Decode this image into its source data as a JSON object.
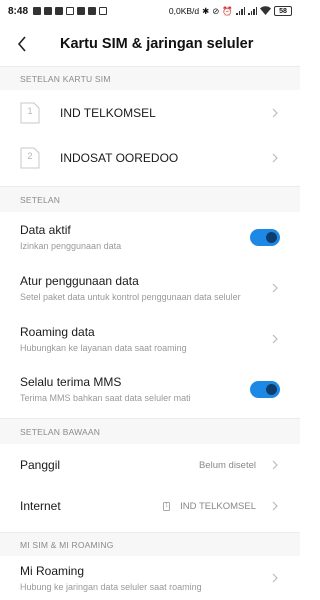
{
  "status_bar": {
    "time": "8:48",
    "network_speed": "0,0KB/d",
    "battery": "58"
  },
  "header": {
    "title": "Kartu SIM & jaringan seluler"
  },
  "sections": {
    "sim_settings": "SETELAN KARTU SIM",
    "settings": "SETELAN",
    "default_settings": "SETELAN BAWAAN",
    "mi_sim": "MI SIM & MI ROAMING"
  },
  "sims": [
    {
      "slot": "1",
      "name": "IND TELKOMSEL"
    },
    {
      "slot": "2",
      "name": "INDOSAT OOREDOO"
    }
  ],
  "settings": {
    "data_aktif": {
      "title": "Data aktif",
      "subtitle": "Izinkan penggunaan data",
      "enabled": true
    },
    "atur_data": {
      "title": "Atur penggunaan data",
      "subtitle": "Setel paket data untuk kontrol penggunaan data seluler"
    },
    "roaming": {
      "title": "Roaming data",
      "subtitle": "Hubungkan ke layanan data saat roaming"
    },
    "mms": {
      "title": "Selalu terima MMS",
      "subtitle": "Terima MMS bahkan saat data seluler mati",
      "enabled": true
    }
  },
  "defaults": {
    "panggil": {
      "title": "Panggil",
      "value": "Belum disetel"
    },
    "internet": {
      "title": "Internet",
      "sim_slot": "1",
      "value": "IND TELKOMSEL"
    }
  },
  "mi": {
    "roaming": {
      "title": "Mi Roaming",
      "subtitle": "Hubung ke jaringan data seluler saat roaming"
    }
  },
  "colors": {
    "accent": "#1e88e5",
    "toggle_knob": "#0d3d6b",
    "section_bg": "#f7f7f7"
  }
}
